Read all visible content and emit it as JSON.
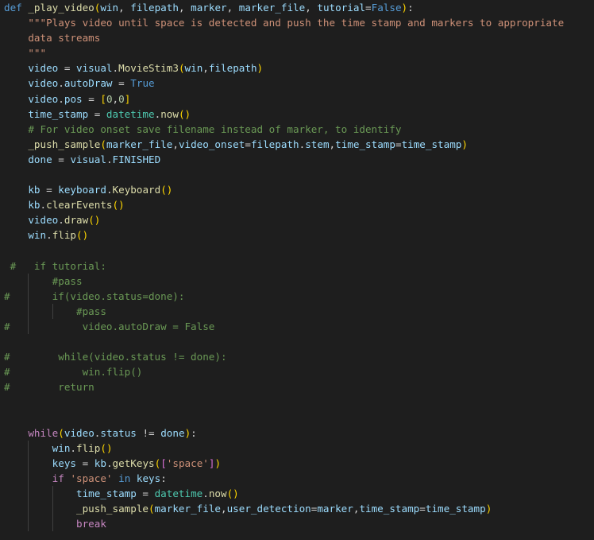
{
  "editor": {
    "language": "python",
    "theme_colors": {
      "background": "#1e1e1e",
      "keyword": "#569cd6",
      "control": "#c586c0",
      "function": "#dcdcaa",
      "variable": "#9cdcfe",
      "class": "#4ec9b0",
      "string": "#ce9178",
      "number": "#b5cea8",
      "comment": "#6a9955",
      "bracket_level1": "#ffd700",
      "bracket_level2": "#da70d6",
      "bracket_level3": "#179fff"
    },
    "lines": [
      {
        "guides": [],
        "tokens": [
          [
            "kw",
            "def"
          ],
          [
            "op",
            " "
          ],
          [
            "fn",
            "_play_video"
          ],
          [
            "br1",
            "("
          ],
          [
            "var",
            "win"
          ],
          [
            "op",
            ", "
          ],
          [
            "var",
            "filepath"
          ],
          [
            "op",
            ", "
          ],
          [
            "var",
            "marker"
          ],
          [
            "op",
            ", "
          ],
          [
            "var",
            "marker_file"
          ],
          [
            "op",
            ", "
          ],
          [
            "var",
            "tutorial"
          ],
          [
            "op",
            "="
          ],
          [
            "kw",
            "False"
          ],
          [
            "br1",
            ")"
          ],
          [
            "op",
            ":"
          ]
        ]
      },
      {
        "guides": [],
        "tokens": [
          [
            "op",
            "    "
          ],
          [
            "str",
            "\"\"\"Plays video until space is detected and push the time stamp and markers to appropriate"
          ]
        ]
      },
      {
        "guides": [],
        "tokens": [
          [
            "op",
            "    "
          ],
          [
            "str",
            "data streams"
          ]
        ]
      },
      {
        "guides": [],
        "tokens": [
          [
            "op",
            "    "
          ],
          [
            "str",
            "\"\"\""
          ]
        ]
      },
      {
        "guides": [],
        "tokens": [
          [
            "op",
            "    "
          ],
          [
            "var",
            "video"
          ],
          [
            "op",
            " = "
          ],
          [
            "var",
            "visual"
          ],
          [
            "op",
            "."
          ],
          [
            "fn",
            "MovieStim3"
          ],
          [
            "br1",
            "("
          ],
          [
            "var",
            "win"
          ],
          [
            "op",
            ","
          ],
          [
            "var",
            "filepath"
          ],
          [
            "br1",
            ")"
          ]
        ]
      },
      {
        "guides": [],
        "tokens": [
          [
            "op",
            "    "
          ],
          [
            "var",
            "video"
          ],
          [
            "op",
            "."
          ],
          [
            "var",
            "autoDraw"
          ],
          [
            "op",
            " = "
          ],
          [
            "kw",
            "True"
          ]
        ]
      },
      {
        "guides": [],
        "tokens": [
          [
            "op",
            "    "
          ],
          [
            "var",
            "video"
          ],
          [
            "op",
            "."
          ],
          [
            "var",
            "pos"
          ],
          [
            "op",
            " = "
          ],
          [
            "br1",
            "["
          ],
          [
            "num",
            "0"
          ],
          [
            "op",
            ","
          ],
          [
            "num",
            "0"
          ],
          [
            "br1",
            "]"
          ]
        ]
      },
      {
        "guides": [],
        "tokens": [
          [
            "op",
            "    "
          ],
          [
            "var",
            "time_stamp"
          ],
          [
            "op",
            " = "
          ],
          [
            "cls",
            "datetime"
          ],
          [
            "op",
            "."
          ],
          [
            "fn",
            "now"
          ],
          [
            "br1",
            "()"
          ]
        ]
      },
      {
        "guides": [],
        "tokens": [
          [
            "op",
            "    "
          ],
          [
            "cmt",
            "# For video onset save filename instead of marker, to identify"
          ]
        ]
      },
      {
        "guides": [],
        "tokens": [
          [
            "op",
            "    "
          ],
          [
            "fn",
            "_push_sample"
          ],
          [
            "br1",
            "("
          ],
          [
            "var",
            "marker_file"
          ],
          [
            "op",
            ","
          ],
          [
            "var",
            "video_onset"
          ],
          [
            "op",
            "="
          ],
          [
            "var",
            "filepath"
          ],
          [
            "op",
            "."
          ],
          [
            "var",
            "stem"
          ],
          [
            "op",
            ","
          ],
          [
            "var",
            "time_stamp"
          ],
          [
            "op",
            "="
          ],
          [
            "var",
            "time_stamp"
          ],
          [
            "br1",
            ")"
          ]
        ]
      },
      {
        "guides": [],
        "tokens": [
          [
            "op",
            "    "
          ],
          [
            "var",
            "done"
          ],
          [
            "op",
            " = "
          ],
          [
            "var",
            "visual"
          ],
          [
            "op",
            "."
          ],
          [
            "var",
            "FINISHED"
          ]
        ]
      },
      {
        "guides": [],
        "tokens": []
      },
      {
        "guides": [],
        "tokens": [
          [
            "op",
            "    "
          ],
          [
            "var",
            "kb"
          ],
          [
            "op",
            " = "
          ],
          [
            "var",
            "keyboard"
          ],
          [
            "op",
            "."
          ],
          [
            "fn",
            "Keyboard"
          ],
          [
            "br1",
            "()"
          ]
        ]
      },
      {
        "guides": [],
        "tokens": [
          [
            "op",
            "    "
          ],
          [
            "var",
            "kb"
          ],
          [
            "op",
            "."
          ],
          [
            "fn",
            "clearEvents"
          ],
          [
            "br1",
            "()"
          ]
        ]
      },
      {
        "guides": [],
        "tokens": [
          [
            "op",
            "    "
          ],
          [
            "var",
            "video"
          ],
          [
            "op",
            "."
          ],
          [
            "fn",
            "draw"
          ],
          [
            "br1",
            "()"
          ]
        ]
      },
      {
        "guides": [],
        "tokens": [
          [
            "op",
            "    "
          ],
          [
            "var",
            "win"
          ],
          [
            "op",
            "."
          ],
          [
            "fn",
            "flip"
          ],
          [
            "br1",
            "()"
          ]
        ]
      },
      {
        "guides": [],
        "tokens": []
      },
      {
        "guides": [],
        "tokens": [
          [
            "cmt",
            " #   if tutorial:"
          ]
        ]
      },
      {
        "guides": [
          4
        ],
        "tokens": [
          [
            "op",
            "        "
          ],
          [
            "cmt",
            "#pass"
          ]
        ]
      },
      {
        "guides": [
          4
        ],
        "tokens": [
          [
            "cmt",
            "#       if(video.status=done):"
          ]
        ]
      },
      {
        "guides": [
          4,
          8
        ],
        "tokens": [
          [
            "op",
            "            "
          ],
          [
            "cmt",
            "#pass"
          ]
        ]
      },
      {
        "guides": [
          4
        ],
        "tokens": [
          [
            "cmt",
            "#            video.autoDraw = False"
          ]
        ]
      },
      {
        "guides": [],
        "tokens": []
      },
      {
        "guides": [],
        "tokens": [
          [
            "cmt",
            "#        while(video.status != done):"
          ]
        ]
      },
      {
        "guides": [],
        "tokens": [
          [
            "cmt",
            "#            win.flip()"
          ]
        ]
      },
      {
        "guides": [],
        "tokens": [
          [
            "cmt",
            "#        return"
          ]
        ]
      },
      {
        "guides": [],
        "tokens": []
      },
      {
        "guides": [],
        "tokens": []
      },
      {
        "guides": [],
        "tokens": [
          [
            "op",
            "    "
          ],
          [
            "ctl",
            "while"
          ],
          [
            "br1",
            "("
          ],
          [
            "var",
            "video"
          ],
          [
            "op",
            "."
          ],
          [
            "var",
            "status"
          ],
          [
            "op",
            " != "
          ],
          [
            "var",
            "done"
          ],
          [
            "br1",
            ")"
          ],
          [
            "op",
            ":"
          ]
        ]
      },
      {
        "guides": [
          4
        ],
        "tokens": [
          [
            "op",
            "        "
          ],
          [
            "var",
            "win"
          ],
          [
            "op",
            "."
          ],
          [
            "fn",
            "flip"
          ],
          [
            "br1",
            "()"
          ]
        ]
      },
      {
        "guides": [
          4
        ],
        "tokens": [
          [
            "op",
            "        "
          ],
          [
            "var",
            "keys"
          ],
          [
            "op",
            " = "
          ],
          [
            "var",
            "kb"
          ],
          [
            "op",
            "."
          ],
          [
            "fn",
            "getKeys"
          ],
          [
            "br1",
            "("
          ],
          [
            "br2",
            "["
          ],
          [
            "str",
            "'space'"
          ],
          [
            "br2",
            "]"
          ],
          [
            "br1",
            ")"
          ]
        ]
      },
      {
        "guides": [
          4
        ],
        "tokens": [
          [
            "op",
            "        "
          ],
          [
            "ctl",
            "if"
          ],
          [
            "op",
            " "
          ],
          [
            "str",
            "'space'"
          ],
          [
            "op",
            " "
          ],
          [
            "kw",
            "in"
          ],
          [
            "op",
            " "
          ],
          [
            "var",
            "keys"
          ],
          [
            "op",
            ":"
          ]
        ]
      },
      {
        "guides": [
          4,
          8
        ],
        "tokens": [
          [
            "op",
            "            "
          ],
          [
            "var",
            "time_stamp"
          ],
          [
            "op",
            " = "
          ],
          [
            "cls",
            "datetime"
          ],
          [
            "op",
            "."
          ],
          [
            "fn",
            "now"
          ],
          [
            "br1",
            "()"
          ]
        ]
      },
      {
        "guides": [
          4,
          8
        ],
        "tokens": [
          [
            "op",
            "            "
          ],
          [
            "fn",
            "_push_sample"
          ],
          [
            "br1",
            "("
          ],
          [
            "var",
            "marker_file"
          ],
          [
            "op",
            ","
          ],
          [
            "var",
            "user_detection"
          ],
          [
            "op",
            "="
          ],
          [
            "var",
            "marker"
          ],
          [
            "op",
            ","
          ],
          [
            "var",
            "time_stamp"
          ],
          [
            "op",
            "="
          ],
          [
            "var",
            "time_stamp"
          ],
          [
            "br1",
            ")"
          ]
        ]
      },
      {
        "guides": [
          4,
          8
        ],
        "tokens": [
          [
            "op",
            "            "
          ],
          [
            "ctl",
            "break"
          ]
        ]
      }
    ]
  }
}
